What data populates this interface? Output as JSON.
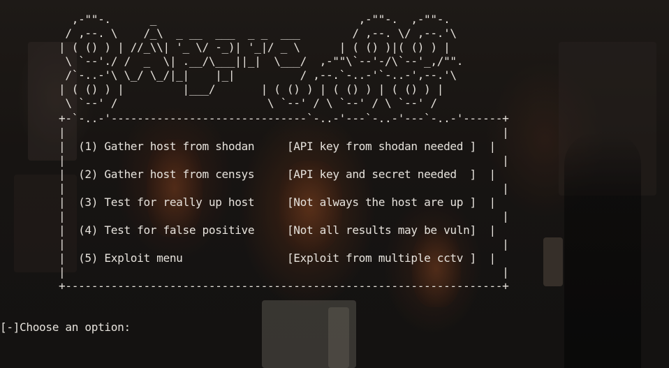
{
  "banner_ascii": [
    "           ,-\"\"-.      _                               ,-\"\"-.  ,-\"\"-.",
    "          / ,--. \\    /_\\  _ __  ___  _ _  ___        / ,--. \\/ ,--.'\\",
    "         | ( () ) | //_\\\\| '_ \\/ -_)| '_|/ _ \\      | ( () )|( () ) |",
    "          \\ `--'./ /  _  \\| .__/\\___||_|  \\___/  ,-\"\"\\`--'-/\\`--'_,/\"\".",
    "          /`-..-'\\ \\_/ \\_/|_|    |_|          / ,--.`-..-'`-..-',--.'\\",
    "         | ( () ) |         |___/       | ( () ) | ( () ) | ( () ) |",
    "          \\ `--' /                       \\ `--' / \\ `--' / \\ `--' /"
  ],
  "menu": {
    "top_border": "         +-`-..-'------------------------------`-..-'---`-..-'---`-..-'------+",
    "bottom_border": "         +-------------------------------------------------------------------+",
    "blank_line": "         |                                                                   |",
    "options": [
      {
        "label": "(1) Gather host from shodan",
        "note": "[API key from shodan needed ]"
      },
      {
        "label": "(2) Gather host from censys",
        "note": "[API key and secret needed  ]"
      },
      {
        "label": "(3) Test for really up host",
        "note": "[Not always the host are up ]"
      },
      {
        "label": "(4) Test for false positive",
        "note": "[Not all results may be vuln]"
      },
      {
        "label": "(5) Exploit menu",
        "note": "[Exploit from multiple cctv ]"
      }
    ]
  },
  "prompt": "[-]Choose an option:"
}
